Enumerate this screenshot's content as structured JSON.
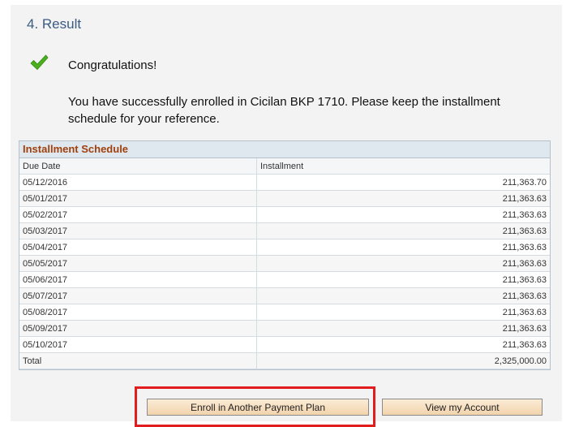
{
  "step": {
    "title": "4. Result"
  },
  "result": {
    "congrats": "Congratulations!",
    "message": "You have successfully enrolled in Cicilan BKP 1710.  Please keep the installment schedule for your reference."
  },
  "schedule": {
    "title": "Installment Schedule",
    "columns": {
      "due_date": "Due Date",
      "installment": "Installment"
    },
    "rows": [
      {
        "date": "05/12/2016",
        "amount": "211,363.70"
      },
      {
        "date": "05/01/2017",
        "amount": "211,363.63"
      },
      {
        "date": "05/02/2017",
        "amount": "211,363.63"
      },
      {
        "date": "05/03/2017",
        "amount": "211,363.63"
      },
      {
        "date": "05/04/2017",
        "amount": "211,363.63"
      },
      {
        "date": "05/05/2017",
        "amount": "211,363.63"
      },
      {
        "date": "05/06/2017",
        "amount": "211,363.63"
      },
      {
        "date": "05/07/2017",
        "amount": "211,363.63"
      },
      {
        "date": "05/08/2017",
        "amount": "211,363.63"
      },
      {
        "date": "05/09/2017",
        "amount": "211,363.63"
      },
      {
        "date": "05/10/2017",
        "amount": "211,363.63"
      }
    ],
    "total": {
      "label": "Total",
      "amount": "2,325,000.00"
    }
  },
  "buttons": {
    "enroll": "Enroll in Another Payment Plan",
    "view_account": "View my Account"
  },
  "colors": {
    "title": "#3b5b82",
    "grid_title": "#a0400c",
    "check": "#4caf1e",
    "highlight": "#e21d1d"
  },
  "icons": {
    "result_icon": "check-icon"
  }
}
